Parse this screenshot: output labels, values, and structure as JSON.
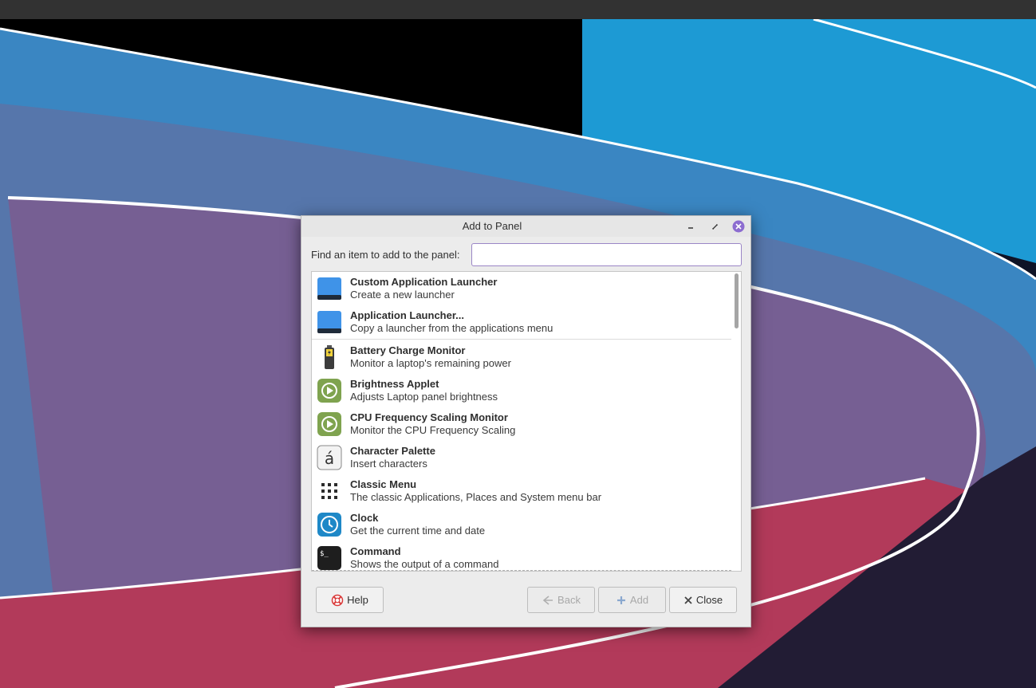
{
  "colors": {
    "accent": "#8c6cd0",
    "wallpaper_blue": "#3d8dc6",
    "wallpaper_purple": "#7a5e95",
    "wallpaper_red": "#b83b5c"
  },
  "dialog": {
    "title": "Add to Panel",
    "window_controls": [
      "minimize-icon",
      "maximize-icon",
      "close-icon"
    ]
  },
  "search": {
    "label": "Find an item to add to the panel:",
    "value": "",
    "placeholder": ""
  },
  "items": [
    {
      "name": "Custom Application Launcher",
      "description": "Create a new launcher",
      "icon": "launcher-icon"
    },
    {
      "name": "Application Launcher...",
      "description": "Copy a launcher from the applications menu",
      "icon": "launcher-icon"
    },
    {
      "name": "Battery Charge Monitor",
      "description": "Monitor a laptop's remaining power",
      "icon": "battery-icon"
    },
    {
      "name": "Brightness Applet",
      "description": "Adjusts Laptop panel brightness",
      "icon": "brightness-icon"
    },
    {
      "name": "CPU Frequency Scaling Monitor",
      "description": "Monitor the CPU Frequency Scaling",
      "icon": "cpu-frequency-icon"
    },
    {
      "name": "Character Palette",
      "description": "Insert characters",
      "icon": "character-palette-icon"
    },
    {
      "name": "Classic Menu",
      "description": "The classic Applications, Places and System menu bar",
      "icon": "grid-menu-icon"
    },
    {
      "name": "Clock",
      "description": "Get the current time and date",
      "icon": "clock-icon"
    },
    {
      "name": "Command",
      "description": "Shows the output of a command",
      "icon": "terminal-icon"
    }
  ],
  "buttons": {
    "help": "Help",
    "back": "Back",
    "add": "Add",
    "close": "Close"
  },
  "character_palette_glyph": "á",
  "terminal_glyph": "$_"
}
